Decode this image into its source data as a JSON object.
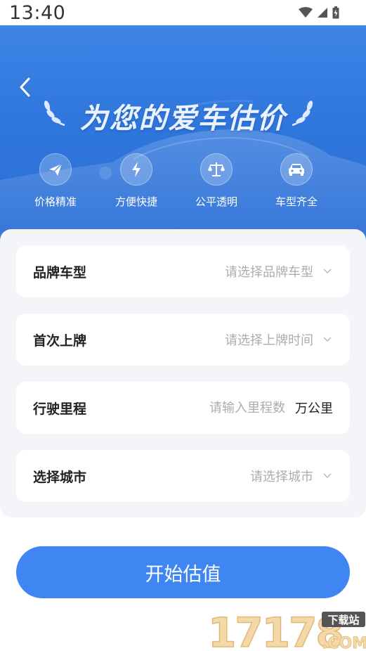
{
  "status_bar": {
    "time": "13:40"
  },
  "header": {
    "title": "为您的爱车估价"
  },
  "features": [
    {
      "label": "价格精准",
      "icon": "paper-plane-icon"
    },
    {
      "label": "方便快捷",
      "icon": "lightning-icon"
    },
    {
      "label": "公平透明",
      "icon": "balance-scale-icon"
    },
    {
      "label": "车型齐全",
      "icon": "car-icon"
    }
  ],
  "form": {
    "brand": {
      "label": "品牌车型",
      "placeholder": "请选择品牌车型"
    },
    "first_registration": {
      "label": "首次上牌",
      "placeholder": "请选择上牌时间"
    },
    "mileage": {
      "label": "行驶里程",
      "placeholder": "请输入里程数",
      "value": "",
      "unit": "万公里"
    },
    "city": {
      "label": "选择城市",
      "placeholder": "请选择城市"
    }
  },
  "submit": {
    "label": "开始估值"
  },
  "watermark": {
    "number": "17178",
    "domain": ".COM",
    "tag": "下载站"
  },
  "colors": {
    "accent": "#3f86f3",
    "hero_blue": "#2f76dc",
    "form_bg": "#f4f5f8",
    "placeholder": "#a9adb3"
  }
}
